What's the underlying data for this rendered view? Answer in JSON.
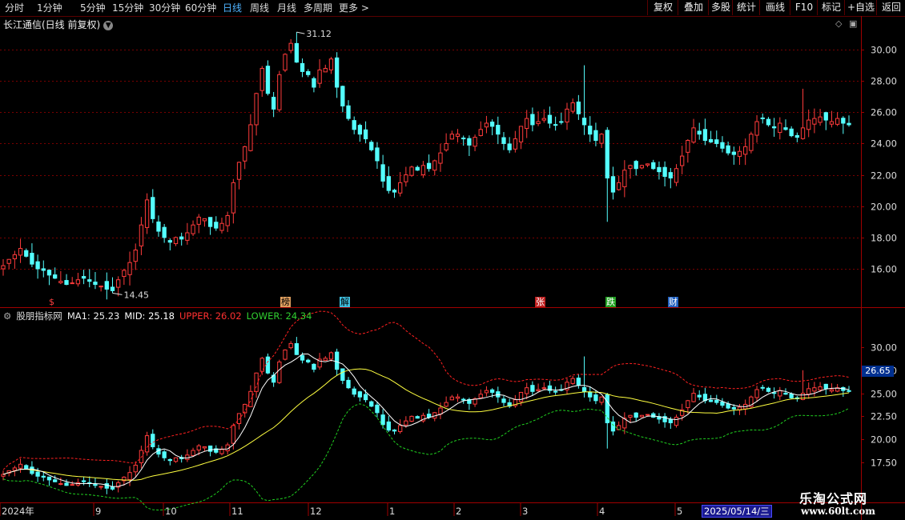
{
  "toolbar": {
    "periods": [
      "分时",
      "1分钟",
      "5分钟",
      "15分钟",
      "30分钟",
      "60分钟",
      "日线",
      "周线",
      "月线",
      "多周期",
      "更多 >"
    ],
    "active_period": "日线",
    "right_buttons": [
      "复权",
      "叠加",
      "多股",
      "统计",
      "画线",
      "F10",
      "标记",
      "+自选",
      "返回"
    ]
  },
  "main_chart": {
    "title": "长江通信(日线 前复权)",
    "y_ticks": [
      "30.00",
      "28.00",
      "26.00",
      "24.00",
      "22.00",
      "20.00",
      "18.00",
      "16.00"
    ],
    "high_label": "31.12",
    "low_label": "14.45",
    "events": [
      "$",
      "榜",
      "解",
      "张",
      "跌",
      "财"
    ]
  },
  "indicator": {
    "name": "股朋指标网",
    "ma1_label": "MA1: 25.23",
    "mid_label": "MID: 25.18",
    "upper_label": "UPPER: 26.02",
    "lower_label": "LOWER: 24.34",
    "y_ticks": [
      "30.00",
      "27.50",
      "25.00",
      "22.50",
      "20.00",
      "17.50"
    ],
    "current_price": "26.65"
  },
  "x_axis": {
    "labels": [
      "2024年",
      "9",
      "10",
      "11",
      "12",
      "1",
      "2",
      "3",
      "4",
      "5"
    ],
    "date_badge": "2025/05/14/三"
  },
  "watermark": {
    "line1": "乐淘公式网",
    "line2": "www.60lt.com"
  },
  "colors": {
    "up": "#ff3b3b",
    "down": "#54ffff",
    "grid": "#7a0000",
    "upper": "#ff2020",
    "lower": "#20d020",
    "ma": "#ffff40",
    "mid": "#ffffff"
  },
  "chart_data": {
    "type": "candlestick",
    "price_range_main": [
      14.45,
      31.12
    ],
    "series": [
      {
        "name": "MA1",
        "last": 25.23
      },
      {
        "name": "MID",
        "last": 25.18
      },
      {
        "name": "UPPER",
        "last": 26.02
      },
      {
        "name": "LOWER",
        "last": 24.34
      }
    ],
    "close_path": [
      16.2,
      16.6,
      16.9,
      17.3,
      16.8,
      16.3,
      16.0,
      15.9,
      15.6,
      15.4,
      15.2,
      15.0,
      15.1,
      15.3,
      15.4,
      15.2,
      15.0,
      14.9,
      14.7,
      14.6,
      15.3,
      15.9,
      16.4,
      17.2,
      18.8,
      20.4,
      19.2,
      18.4,
      18.0,
      17.7,
      18.0,
      17.9,
      18.3,
      18.8,
      19.3,
      19.2,
      18.7,
      18.6,
      18.9,
      19.4,
      21.5,
      22.8,
      23.8,
      25.2,
      27.2,
      28.8,
      27.2,
      26.2,
      28.4,
      29.7,
      30.4,
      29.2,
      28.6,
      28.4,
      27.6,
      28.7,
      28.8,
      29.4,
      27.6,
      26.4,
      25.6,
      24.9,
      24.6,
      24.3,
      23.6,
      22.9,
      21.6,
      21.0,
      20.9,
      21.5,
      22.0,
      22.5,
      22.3,
      22.6,
      22.4,
      22.9,
      23.4,
      24.0,
      24.6,
      24.6,
      24.3,
      23.9,
      24.4,
      24.9,
      25.3,
      25.1,
      24.6,
      24.0,
      23.6,
      24.3,
      25.1,
      25.6,
      25.2,
      25.4,
      25.6,
      25.3,
      25.2,
      25.4,
      26.2,
      26.6,
      25.9,
      25.2,
      24.6,
      24.2,
      24.6,
      21.8,
      20.9,
      21.5,
      22.3,
      22.6,
      22.4,
      22.6,
      22.7,
      22.4,
      22.2,
      21.9,
      21.8,
      22.4,
      23.2,
      24.2,
      25.0,
      24.6,
      24.2,
      24.1,
      24.0,
      23.7,
      23.4,
      23.3,
      23.5,
      23.8,
      24.6,
      25.4,
      25.6,
      25.2,
      25.0,
      25.3,
      24.9,
      24.5,
      24.4,
      25.0,
      25.5,
      25.6,
      25.7,
      25.5,
      25.4,
      25.6,
      25.3,
      25.2
    ]
  }
}
